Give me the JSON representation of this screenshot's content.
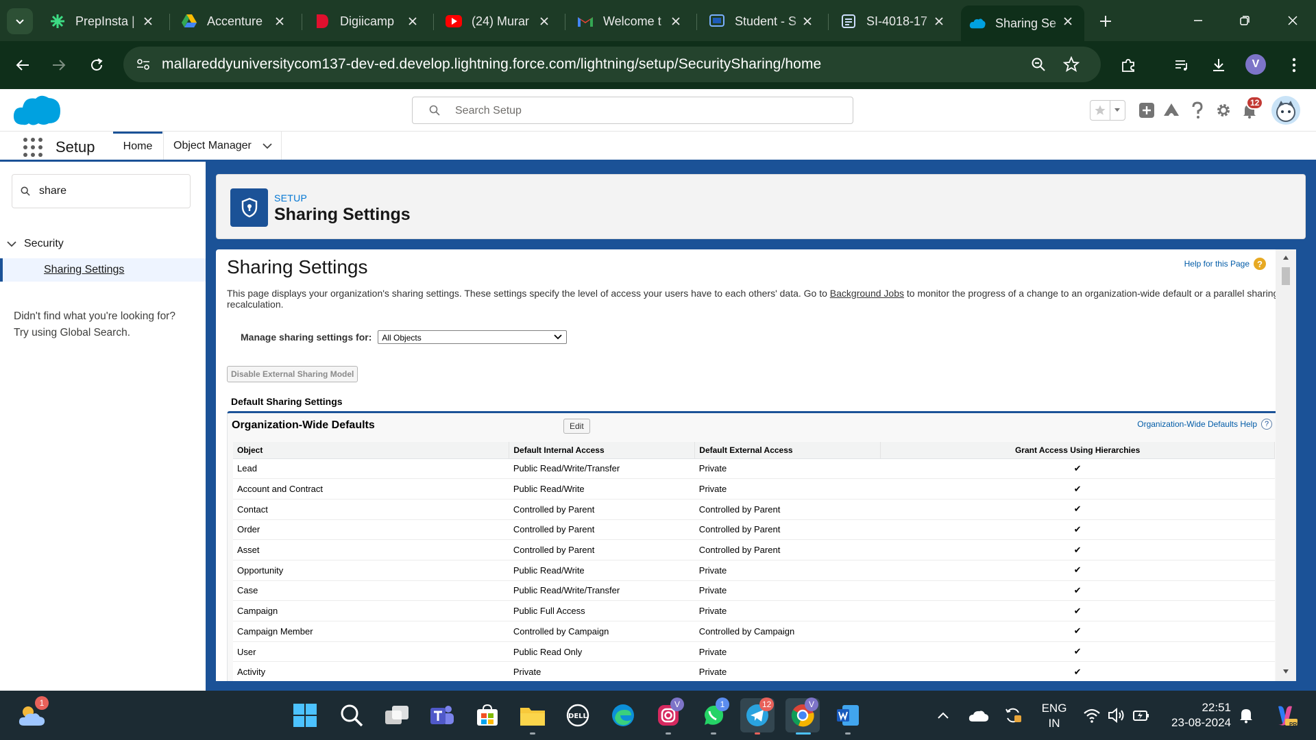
{
  "browser": {
    "tabs": [
      {
        "title": "PrepInsta |",
        "icon": "prepinsta-icon"
      },
      {
        "title": "Accenture",
        "icon": "google-drive-icon"
      },
      {
        "title": "Digiicamp",
        "icon": "digiicamp-icon"
      },
      {
        "title": "(24) Murar",
        "icon": "youtube-icon"
      },
      {
        "title": "Welcome t",
        "icon": "gmail-icon"
      },
      {
        "title": "Student - S",
        "icon": "student-portal-icon"
      },
      {
        "title": "SI-4018-17",
        "icon": "document-icon"
      },
      {
        "title": "Sharing Se",
        "icon": "salesforce-cloud-icon",
        "active": true
      }
    ],
    "url": "mallareddyuniversitycom137-dev-ed.develop.lightning.force.com/lightning/setup/SecuritySharing/home",
    "profile_initial": "V",
    "theme_color": "#0f2f1a"
  },
  "sf_header": {
    "search_placeholder": "Search Setup",
    "notification_count": "12"
  },
  "setup_nav": {
    "app_name": "Setup",
    "tabs": [
      "Home",
      "Object Manager"
    ]
  },
  "sidebar": {
    "quick_find_value": "share",
    "tree_node": "Security",
    "tree_leaf": "Sharing Settings",
    "not_found_line1": "Didn't find what you're looking for?",
    "not_found_line2": "Try using Global Search."
  },
  "page_header": {
    "eyebrow": "SETUP",
    "title": "Sharing Settings"
  },
  "content": {
    "title": "Sharing Settings",
    "help_link": "Help for this Page",
    "description_part1": "This page displays your organization's sharing settings. These settings specify the level of access your users have to each others' data. Go to ",
    "description_link": "Background Jobs",
    "description_part2": " to monitor the progress of a change to an organization-wide default or a parallel sharing recalculation.",
    "manage_label": "Manage sharing settings for:",
    "manage_value": "All Objects",
    "disable_button": "Disable External Sharing Model",
    "section_label": "Default Sharing Settings",
    "owd_title": "Organization-Wide Defaults",
    "edit_button": "Edit",
    "owd_help": "Organization-Wide Defaults Help",
    "columns": [
      "Object",
      "Default Internal Access",
      "Default External Access",
      "Grant Access Using Hierarchies"
    ],
    "rows": [
      {
        "object": "Lead",
        "internal": "Public Read/Write/Transfer",
        "external": "Private",
        "grant": "✔"
      },
      {
        "object": "Account and Contract",
        "internal": "Public Read/Write",
        "external": "Private",
        "grant": "✔"
      },
      {
        "object": "Contact",
        "internal": "Controlled by Parent",
        "external": "Controlled by Parent",
        "grant": "✔"
      },
      {
        "object": "Order",
        "internal": "Controlled by Parent",
        "external": "Controlled by Parent",
        "grant": "✔"
      },
      {
        "object": "Asset",
        "internal": "Controlled by Parent",
        "external": "Controlled by Parent",
        "grant": "✔"
      },
      {
        "object": "Opportunity",
        "internal": "Public Read/Write",
        "external": "Private",
        "grant": "✔"
      },
      {
        "object": "Case",
        "internal": "Public Read/Write/Transfer",
        "external": "Private",
        "grant": "✔"
      },
      {
        "object": "Campaign",
        "internal": "Public Full Access",
        "external": "Private",
        "grant": "✔"
      },
      {
        "object": "Campaign Member",
        "internal": "Controlled by Campaign",
        "external": "Controlled by Campaign",
        "grant": "✔"
      },
      {
        "object": "User",
        "internal": "Public Read Only",
        "external": "Private",
        "grant": "✔"
      },
      {
        "object": "Activity",
        "internal": "Private",
        "external": "Private",
        "grant": "✔"
      }
    ]
  },
  "taskbar": {
    "weather_badge": "1",
    "instagram_badge": "V",
    "whatsapp_badge": "1",
    "telegram_badge": "12",
    "chrome_badge": "V",
    "language_line1": "ENG",
    "language_line2": "IN",
    "time": "22:51",
    "date": "23-08-2024",
    "copilot_label": "PRE"
  }
}
